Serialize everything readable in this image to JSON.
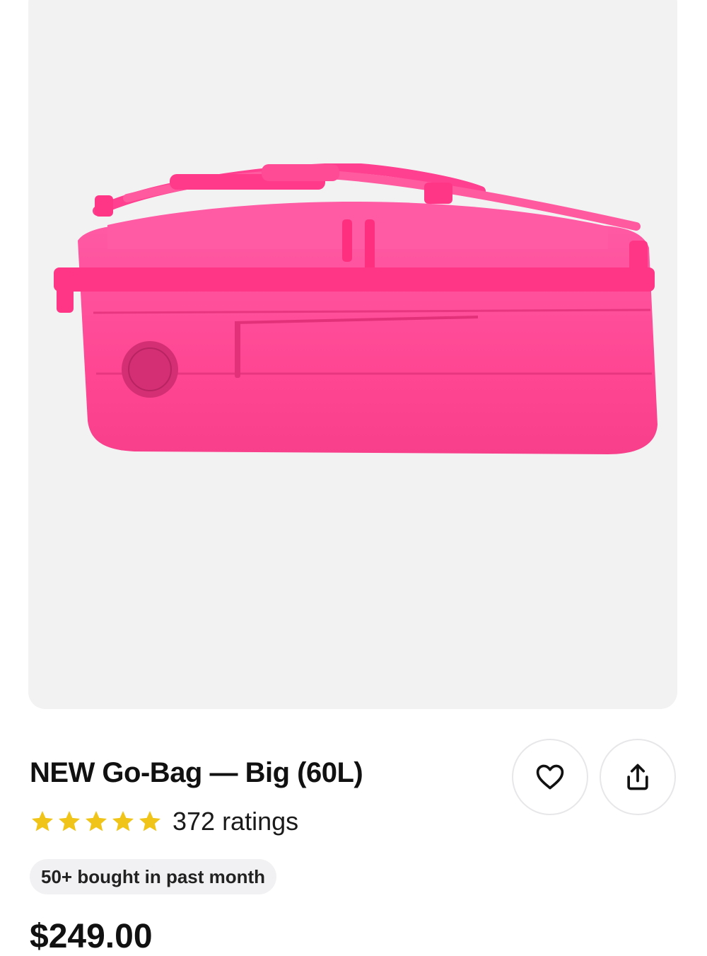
{
  "product": {
    "image_alt": "Pink Go-Bag Big 60L duffel",
    "title": "NEW Go-Bag — Big (60L)",
    "rating": 5,
    "stars_max": 5,
    "ratings_label": "372 ratings",
    "purchase_badge": "50+ bought in past month",
    "price": "$249.00"
  },
  "actions": {
    "favorite_icon": "heart-icon",
    "share_icon": "share-icon"
  },
  "colors": {
    "bag_pink": "#ff4f9a",
    "star_gold": "#f0c419",
    "image_background": "#f3f2f3",
    "badge_background": "#f1f1f3"
  }
}
